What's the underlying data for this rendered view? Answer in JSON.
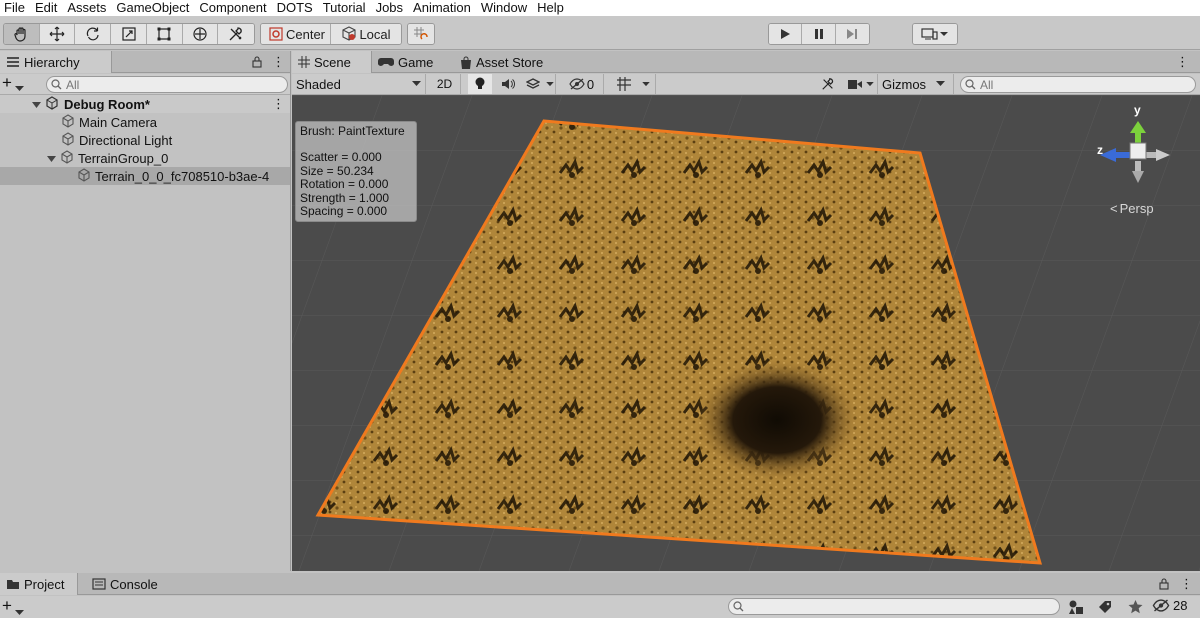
{
  "menu": [
    "File",
    "Edit",
    "Assets",
    "GameObject",
    "Component",
    "DOTS",
    "Tutorial",
    "Jobs",
    "Animation",
    "Window",
    "Help"
  ],
  "toolbar": {
    "pivot_label": "Center",
    "space_label": "Local"
  },
  "hierarchy": {
    "tab_label": "Hierarchy",
    "search_placeholder": "All",
    "scene_name": "Debug Room*",
    "items": [
      {
        "label": "Main Camera"
      },
      {
        "label": "Directional Light"
      },
      {
        "label": "TerrainGroup_0"
      },
      {
        "label": "Terrain_0_0_fc708510-b3ae-4"
      }
    ]
  },
  "scene_tabs": {
    "scene": "Scene",
    "game": "Game",
    "asset_store": "Asset Store"
  },
  "scene_toolbar": {
    "draw_mode": "Shaded",
    "two_d": "2D",
    "hidden_count": "0",
    "gizmos": "Gizmos",
    "search_placeholder": "All"
  },
  "brush_info": {
    "title": "Brush: PaintTexture",
    "lines": [
      "Scatter = 0.000",
      "Size = 50.234",
      "Rotation = 0.000",
      "Strength = 1.000",
      "Spacing = 0.000"
    ]
  },
  "gizmo": {
    "y_label": "y",
    "z_label": "z",
    "projection": "Persp"
  },
  "bottom": {
    "project_tab": "Project",
    "console_tab": "Console",
    "hidden_count": "28"
  },
  "colors": {
    "terrain": "#b0863a",
    "selection_outline": "#f07a1e",
    "scene_bg": "#4b4b4b"
  }
}
